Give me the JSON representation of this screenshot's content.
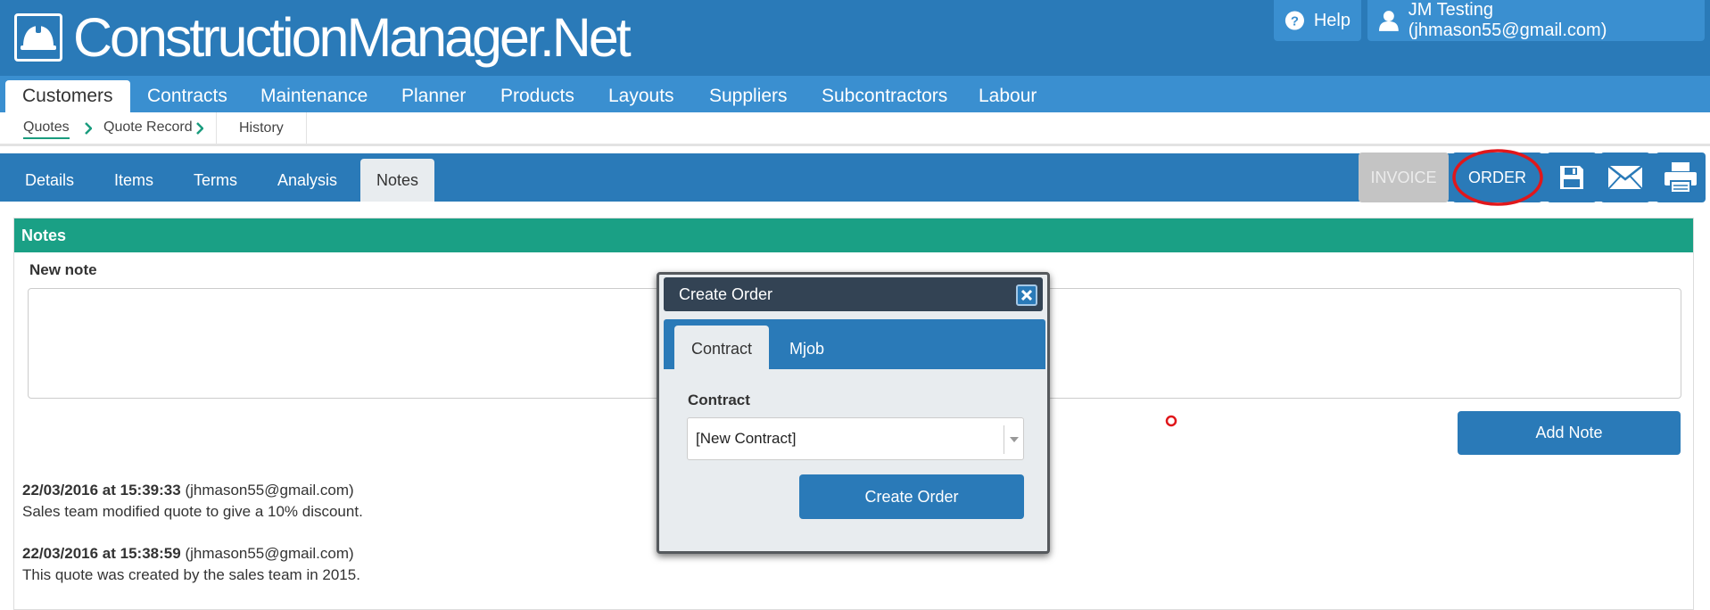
{
  "brand": {
    "name": "ConstructionManager.Net"
  },
  "header": {
    "help_label": "Help",
    "user_label": "JM Testing (jhmason55@gmail.com)"
  },
  "main_nav": [
    "Customers",
    "Contracts",
    "Maintenance",
    "Planner",
    "Products",
    "Layouts",
    "Suppliers",
    "Subcontractors",
    "Labour"
  ],
  "breadcrumb": [
    "Quotes",
    "Quote Record",
    "History"
  ],
  "sub_tabs": [
    "Details",
    "Items",
    "Terms",
    "Analysis",
    "Notes"
  ],
  "actions": {
    "invoice": "INVOICE",
    "order": "ORDER"
  },
  "notes": {
    "panel_title": "Notes",
    "new_note_label": "New note",
    "add_note_label": "Add Note",
    "entries": [
      {
        "timestamp": "22/03/2016 at 15:39:33",
        "author": "(jhmason55@gmail.com)",
        "text": "Sales team modified quote to give a 10% discount."
      },
      {
        "timestamp": "22/03/2016 at 15:38:59",
        "author": "(jhmason55@gmail.com)",
        "text": "This quote was created by the sales team in 2015."
      }
    ]
  },
  "modal": {
    "title": "Create Order",
    "tabs": [
      "Contract",
      "Mjob"
    ],
    "contract_label": "Contract",
    "contract_value": "[New Contract]",
    "create_label": "Create Order"
  },
  "colors": {
    "header_blue": "#2a7ab8",
    "nav_blue": "#3a8fd0",
    "notes_green": "#1aa085",
    "modal_title": "#334354",
    "invoice_disabled": "#c4c4c4",
    "annotation_red": "#e0171b"
  }
}
